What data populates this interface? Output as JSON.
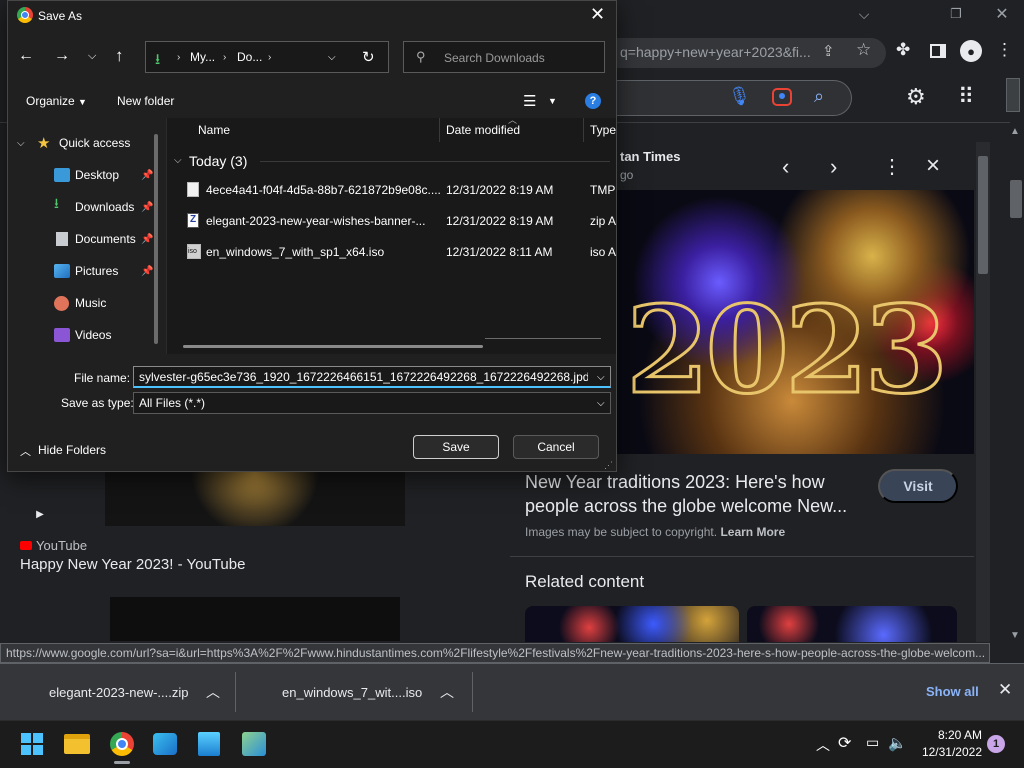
{
  "browser": {
    "omnibox_url": "q=happy+new+year+2023&fi...",
    "status_url": "https://www.google.com/url?sa=i&url=https%3A%2F%2Fwww.hindustantimes.com%2Flifestyle%2Ffestivals%2Fnew-year-traditions-2023-here-s-how-people-across-the-globe-welcom..."
  },
  "panel": {
    "source": "tan Times",
    "sub": "go",
    "fireworks_text": "2023",
    "title": "New Year traditions 2023: Here's how people across the globe welcome New...",
    "visit_label": "Visit",
    "copyright": "Images may be subject to copyright. ",
    "learn_more": "Learn More",
    "related": "Related content"
  },
  "results": {
    "yt_source": "YouTube",
    "yt_title": "Happy New Year 2023! - YouTube"
  },
  "dialog": {
    "title": "Save As",
    "breadcrumb": [
      "My...",
      "Do..."
    ],
    "search_placeholder": "Search Downloads",
    "organize_label": "Organize",
    "newfolder_label": "New folder",
    "quick_access": "Quick access",
    "nav_items": [
      {
        "label": "Desktop",
        "pinned": true
      },
      {
        "label": "Downloads",
        "pinned": true
      },
      {
        "label": "Documents",
        "pinned": true
      },
      {
        "label": "Pictures",
        "pinned": true
      },
      {
        "label": "Music",
        "pinned": false
      },
      {
        "label": "Videos",
        "pinned": false
      }
    ],
    "columns": {
      "name": "Name",
      "date": "Date modified",
      "type": "Type"
    },
    "group_label": "Today (3)",
    "files": [
      {
        "name": "4ece4a41-f04f-4d5a-88b7-621872b9e08c....",
        "date": "12/31/2022 8:19 AM",
        "type": "TMP"
      },
      {
        "name": "elegant-2023-new-year-wishes-banner-...",
        "date": "12/31/2022 8:19 AM",
        "type": "zip A"
      },
      {
        "name": "en_windows_7_with_sp1_x64.iso",
        "date": "12/31/2022 8:11 AM",
        "type": "iso A"
      }
    ],
    "filename_label": "File name:",
    "filename_value": "sylvester-g65ec3e736_1920_1672226466151_1672226492268_1672226492268.jpd",
    "savetype_label": "Save as type:",
    "savetype_value": "All Files (*.*)",
    "hide_folders": "Hide Folders",
    "save_label": "Save",
    "cancel_label": "Cancel"
  },
  "downloads": {
    "items": [
      {
        "name": "elegant-2023-new-....zip"
      },
      {
        "name": "en_windows_7_wit....iso"
      }
    ],
    "show_all": "Show all"
  },
  "taskbar": {
    "time": "8:20 AM",
    "date": "12/31/2022",
    "notifications": "1"
  }
}
